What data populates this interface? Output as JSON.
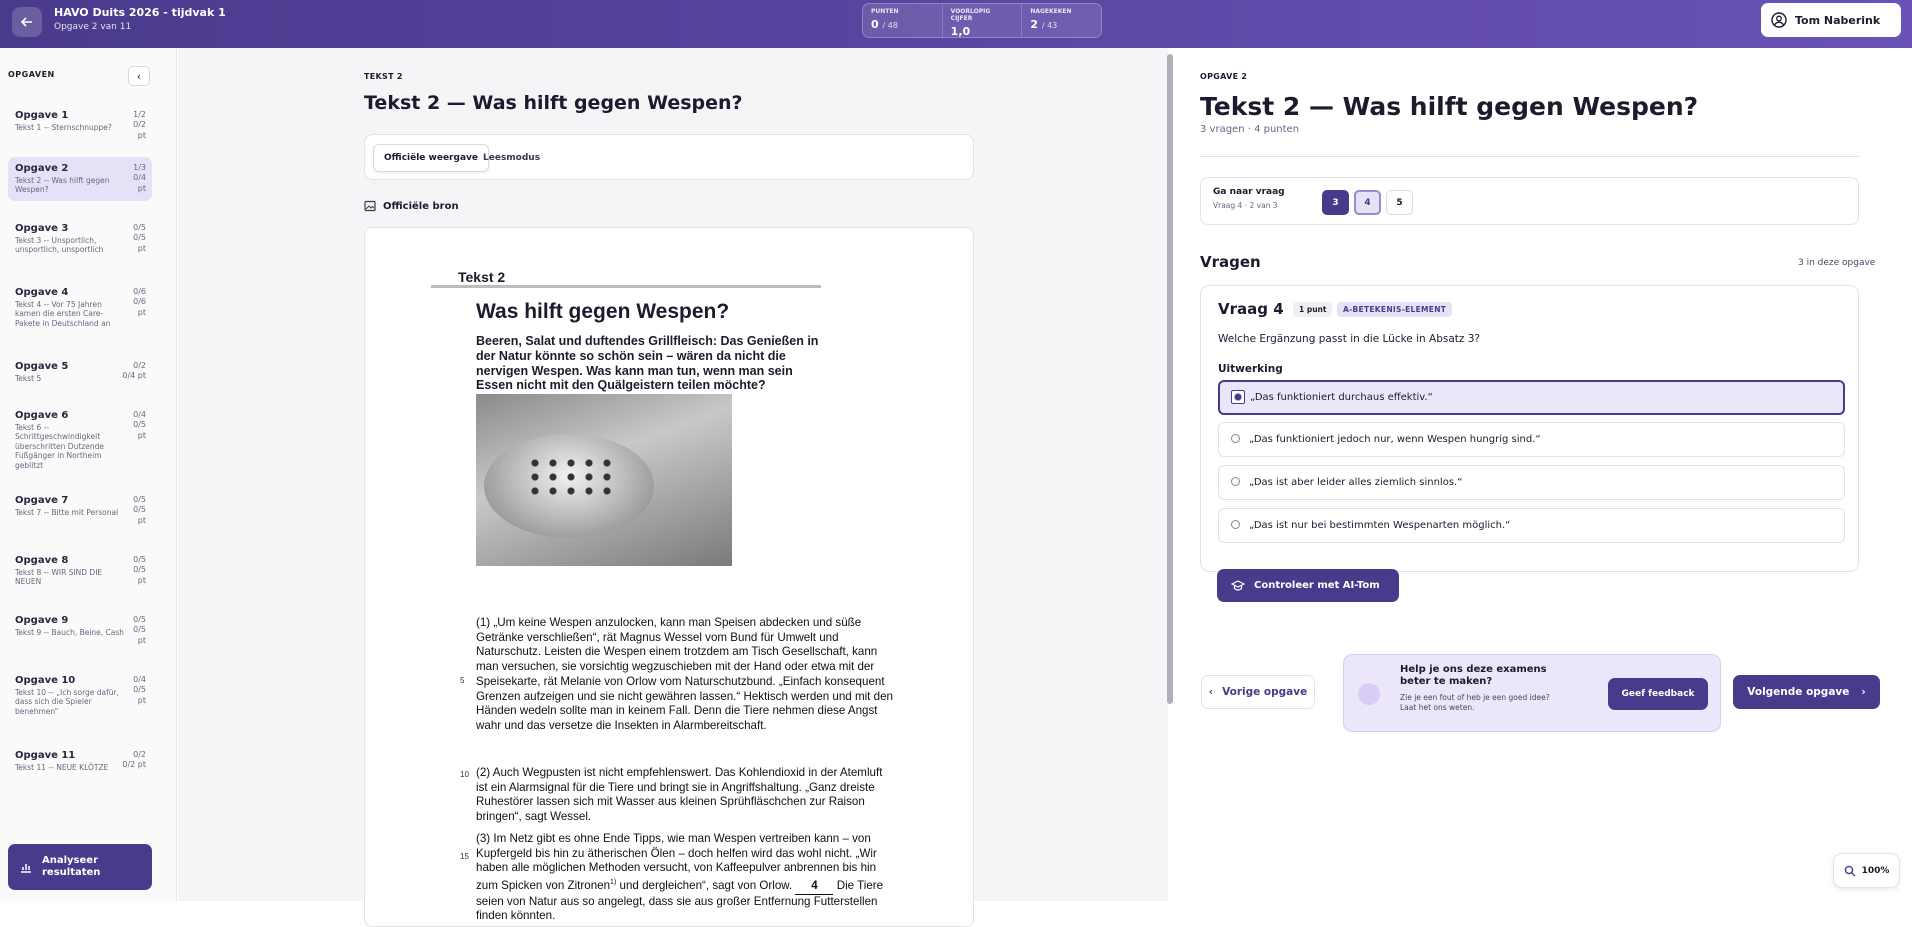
{
  "header": {
    "title": "HAVO Duits 2026 - tijdvak 1",
    "subtitle": "Opgave 2 van 11",
    "stats": [
      {
        "label": "PUNTEN",
        "value": "0",
        "suffix": "/ 48"
      },
      {
        "label": "VOORLOPIG CIJFER",
        "value": "1,0",
        "suffix": ""
      },
      {
        "label": "NAGEKEKEN",
        "value": "2",
        "suffix": "/ 43"
      }
    ],
    "user": "Tom Naberink"
  },
  "sidebar": {
    "heading": "OPGAVEN",
    "items": [
      {
        "title": "Opgave 1",
        "desc": "Tekst 1 -- Sternschnuppe?",
        "q": "1/2",
        "pt": "0/2",
        "unit": "pt"
      },
      {
        "title": "Opgave 2",
        "desc": "Tekst 2 -- Was hilft gegen Wespen?",
        "q": "1/3",
        "pt": "0/4",
        "unit": "pt"
      },
      {
        "title": "Opgave 3",
        "desc": "Tekst 3 -- Unsportlich, unsportlich, unsportlich",
        "q": "0/5",
        "pt": "0/5",
        "unit": "pt"
      },
      {
        "title": "Opgave 4",
        "desc": "Tekst 4 -- Vor 75 Jahren kamen die ersten Care-Pakete in Deutschland an",
        "q": "0/6",
        "pt": "0/6",
        "unit": "pt"
      },
      {
        "title": "Opgave 5",
        "desc": "Tekst 5",
        "q": "0/2",
        "pt": "0/4 pt",
        "unit": ""
      },
      {
        "title": "Opgave 6",
        "desc": "Tekst 6 -- Schrittgeschwindigkeit überschritten Dutzende Fußgänger in Northeim geblitzt",
        "q": "0/4",
        "pt": "0/5",
        "unit": "pt"
      },
      {
        "title": "Opgave 7",
        "desc": "Tekst 7 -- Bitte mit Personal",
        "q": "0/5",
        "pt": "0/5",
        "unit": "pt"
      },
      {
        "title": "Opgave 8",
        "desc": "Tekst 8 -- WIR SIND DIE NEUEN",
        "q": "0/5",
        "pt": "0/5",
        "unit": "pt"
      },
      {
        "title": "Opgave 9",
        "desc": "Tekst 9 -- Bauch, Beine, Cash",
        "q": "0/5",
        "pt": "0/5",
        "unit": "pt"
      },
      {
        "title": "Opgave 10",
        "desc": "Tekst 10 -- „Ich sorge dafür, dass sich die Spieler benehmen“",
        "q": "0/4",
        "pt": "0/5",
        "unit": "pt"
      },
      {
        "title": "Opgave 11",
        "desc": "Tekst 11 -- NEUE KLÖTZE",
        "q": "0/2",
        "pt": "0/2 pt",
        "unit": ""
      }
    ],
    "analyse": "Analyseer resultaten"
  },
  "center": {
    "label": "TEKST 2",
    "title": "Tekst 2 — Was hilft gegen Wespen?",
    "toggle_official": "Officiële weergave",
    "toggle_read": "Leesmodus",
    "source": "Officiële bron",
    "doc": {
      "header": "Tekst 2",
      "title": "Was hilft gegen Wespen?",
      "lead": "Beeren, Salat und duftendes Grillfleisch: Das Genießen in der Natur könnte so schön sein – wären da nicht die nervigen Wespen. Was kann man tun, wenn man sein Essen nicht mit den Quälgeistern teilen möchte?",
      "p1": "(1) „Um keine Wespen anzulocken, kann man Speisen abdecken und süße Getränke verschließen“, rät Magnus Wessel vom Bund für Umwelt und Naturschutz. Leisten die Wespen einem trotzdem am Tisch Gesellschaft, kann man versuchen, sie vorsichtig wegzuschieben mit der Hand oder etwa mit der Speisekarte, rät Melanie von Orlow vom Naturschutzbund. „Einfach konsequent Grenzen aufzeigen und sie nicht gewähren lassen.“ Hektisch werden und mit den Händen wedeln sollte man in keinem Fall. Denn die Tiere nehmen diese Angst wahr und das versetze die Insekten in Alarmbereitschaft.",
      "p2": "(2) Auch Wegpusten ist nicht empfehlenswert. Das Kohlendioxid in der Atemluft ist ein Alarmsignal für die Tiere und bringt sie in Angriffshaltung. „Ganz dreiste Ruhestörer lassen sich mit Wasser aus kleinen Sprühfläschchen zur Raison bringen“, sagt Wessel.",
      "p3a": "(3) Im Netz gibt es ohne Ende Tipps, wie man Wespen vertreiben kann – von Kupfergeld bis hin zu ätherischen Ölen – doch helfen wird das wohl nicht. „Wir haben alle möglichen Methoden versucht, von Kaffeepulver anbrennen bis hin zum Spicken von Zitronen",
      "p3sup": "1)",
      "p3b": " und dergleichen“, sagt von Orlow.",
      "p3gap": "4",
      "p3c": " Die Tiere seien von Natur aus so angelegt, dass sie aus großer Entfernung Futterstellen finden könnten.",
      "line5": "5",
      "line10": "10",
      "line15": "15"
    }
  },
  "right": {
    "label": "OPGAVE 2",
    "title": "Tekst 2 — Was hilft gegen Wespen?",
    "sub": "3 vragen · 4 punten",
    "goto_title": "Ga naar vraag",
    "goto_sub": "Vraag 4 · 2 van 3",
    "q_buttons": [
      "3",
      "4",
      "5"
    ],
    "vragen": "Vragen",
    "vragen_count": "3 in deze opgave",
    "question": {
      "title": "Vraag 4",
      "points": "1 punt",
      "tag": "A-BETEKENIS-ELEMENT",
      "text": "Welche Ergänzung passt in die Lücke in Absatz 3?",
      "uitwerking": "Uitwerking",
      "options": [
        "„Das funktioniert durchaus effektiv.“",
        "„Das funktioniert jedoch nur, wenn Wespen hungrig sind.“",
        "„Das ist aber leider alles ziemlich sinnlos.“",
        "„Das ist nur bei bestimmten Wespenarten möglich.“"
      ],
      "check": "Controleer met AI-Tom"
    },
    "prev": "Vorige opgave",
    "feedback_title": "Help je ons deze examens beter te maken?",
    "feedback_sub": "Zie je een fout of heb je een goed idee? Laat het ons weten.",
    "feedback_btn": "Geef feedback",
    "next": "Volgende opgave"
  },
  "zoom": "100%"
}
